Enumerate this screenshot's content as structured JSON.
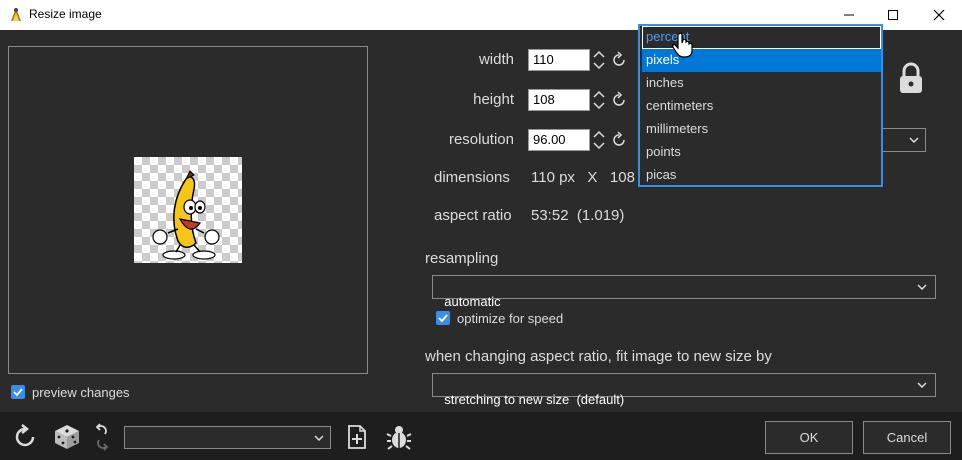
{
  "window": {
    "title": "Resize image"
  },
  "preview": {
    "checkbox_label": "preview changes",
    "checked": true
  },
  "size": {
    "width_label": "width",
    "width_value": "110",
    "height_label": "height",
    "height_value": "108",
    "resolution_label": "resolution",
    "resolution_value": "96.00",
    "dimensions_label": "dimensions",
    "dimensions_value": "110 px   X   108",
    "aspect_label": "aspect ratio",
    "aspect_value": "53:52  (1.019)"
  },
  "unit_dropdown": {
    "current": "percent",
    "hovered": "pixels",
    "options": [
      "percent",
      "pixels",
      "inches",
      "centimeters",
      "millimeters",
      "points",
      "picas"
    ]
  },
  "resampling": {
    "label": "resampling",
    "value": "automatic",
    "optimize_label": "optimize for speed",
    "optimize_checked": true
  },
  "fit": {
    "label": "when changing aspect ratio, fit image to new size by",
    "value": "stretching to new size  (default)"
  },
  "buttons": {
    "ok": "OK",
    "cancel": "Cancel"
  },
  "colors": {
    "accent": "#3a8ee6",
    "highlight": "#0078d7",
    "background": "#2b2b2b",
    "bottom_bar": "#1e1e1e"
  }
}
